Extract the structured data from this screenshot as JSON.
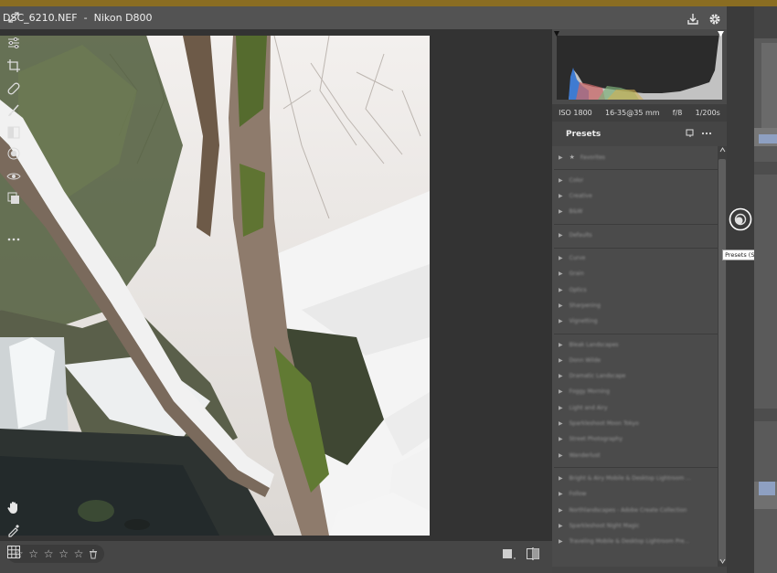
{
  "title": {
    "filename": "DSC_6210.NEF",
    "sep": "-",
    "camera": "Nikon D800"
  },
  "camera_info": {
    "iso": "ISO 1800",
    "lens": "16-35@35 mm",
    "aperture": "f/8",
    "shutter": "1/200s"
  },
  "presets_panel": {
    "title": "Presets",
    "groups": [
      [
        "Favorites"
      ],
      [
        "Color",
        "Creative",
        "B&W"
      ],
      [
        "Defaults"
      ],
      [
        "Curve",
        "Grain",
        "Optics",
        "Sharpening",
        "Vignetting"
      ],
      [
        "Bleak Landscapes",
        "Donn Wilde",
        "Dramatic Landscape",
        "Foggy Morning",
        "Light and Airy",
        "Sparkleshoot Moon Tokyo",
        "Street Photography",
        "Wanderlust"
      ],
      [
        "Bright & Airy Mobile & Desktop Lightroom ...",
        "Follow",
        "Northlandscapes - Adobe Create Collection",
        "Sparkleshoot Night Magic",
        "Traveling Mobile & Desktop Lightroom Pre..."
      ]
    ]
  },
  "tooltip": "Presets (Shift-P)",
  "rating": {
    "stars": [
      "☆",
      "☆",
      "☆",
      "☆",
      "☆"
    ]
  },
  "colors": {
    "accent_bar": "#8a6d22",
    "panel_bg": "#454545",
    "list_bg": "#4b4b4b"
  }
}
